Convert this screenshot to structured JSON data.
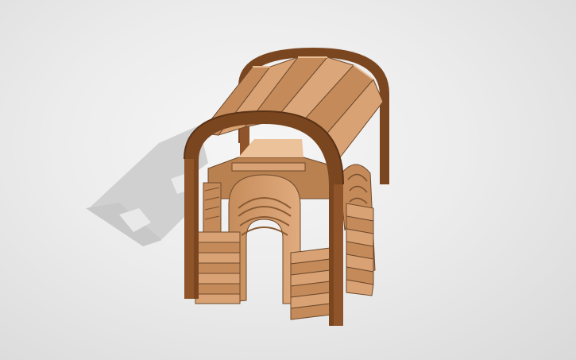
{
  "scene": {
    "subject_icon": "wooden-arched-hut-model",
    "colors": {
      "background_light": "#f6f6f6",
      "background_dark": "#d9d9d9",
      "shadow": "#c9c9c9",
      "arch_dark": "#7a4620",
      "arch_mid": "#8f5429",
      "plank_light": "#d9a274",
      "plank_mid": "#c48a5a",
      "plank_dark": "#a86d3f",
      "plank_edge": "#6e4a2c"
    }
  }
}
